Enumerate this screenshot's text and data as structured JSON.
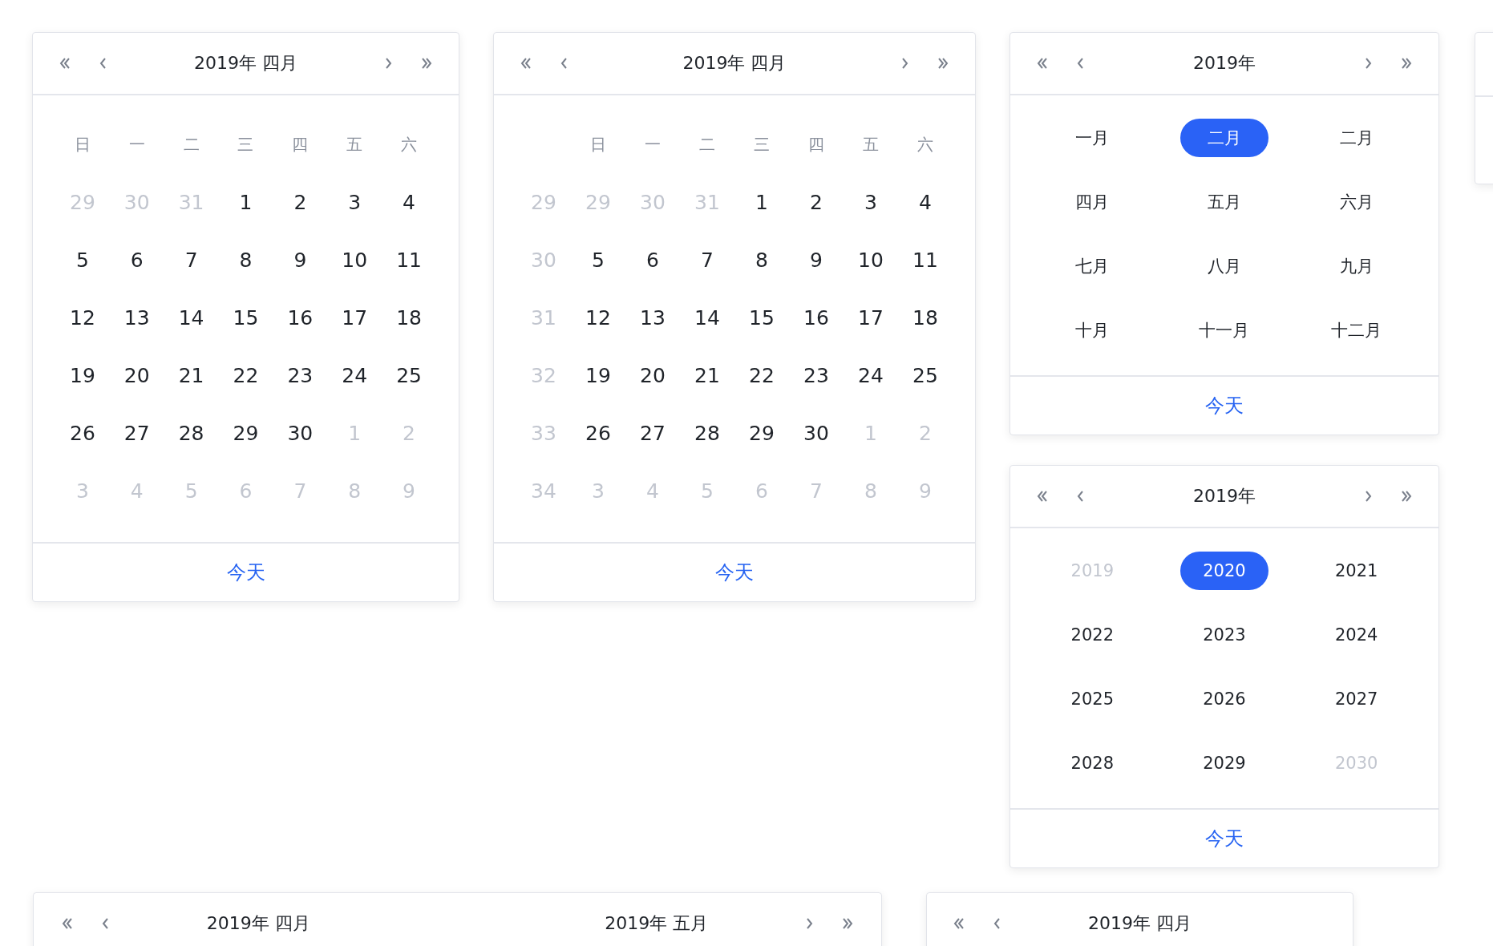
{
  "day_calendars": [
    {
      "title": "2019年 四月",
      "weekdays": [
        "日",
        "一",
        "二",
        "三",
        "四",
        "五",
        "六"
      ],
      "rows": [
        {
          "days": [
            {
              "text": "29",
              "in_month": false
            },
            {
              "text": "30",
              "in_month": false
            },
            {
              "text": "31",
              "in_month": false
            },
            {
              "text": "1",
              "in_month": true
            },
            {
              "text": "2",
              "in_month": true
            },
            {
              "text": "3",
              "in_month": true
            },
            {
              "text": "4",
              "in_month": true
            }
          ]
        },
        {
          "days": [
            {
              "text": "5",
              "in_month": true
            },
            {
              "text": "6",
              "in_month": true
            },
            {
              "text": "7",
              "in_month": true
            },
            {
              "text": "8",
              "in_month": true
            },
            {
              "text": "9",
              "in_month": true
            },
            {
              "text": "10",
              "in_month": true
            },
            {
              "text": "11",
              "in_month": true
            }
          ]
        },
        {
          "days": [
            {
              "text": "12",
              "in_month": true
            },
            {
              "text": "13",
              "in_month": true
            },
            {
              "text": "14",
              "in_month": true
            },
            {
              "text": "15",
              "in_month": true
            },
            {
              "text": "16",
              "in_month": true
            },
            {
              "text": "17",
              "in_month": true
            },
            {
              "text": "18",
              "in_month": true
            }
          ]
        },
        {
          "days": [
            {
              "text": "19",
              "in_month": true
            },
            {
              "text": "20",
              "in_month": true
            },
            {
              "text": "21",
              "in_month": true
            },
            {
              "text": "22",
              "in_month": true
            },
            {
              "text": "23",
              "in_month": true
            },
            {
              "text": "24",
              "in_month": true
            },
            {
              "text": "25",
              "in_month": true
            }
          ]
        },
        {
          "days": [
            {
              "text": "26",
              "in_month": true
            },
            {
              "text": "27",
              "in_month": true
            },
            {
              "text": "28",
              "in_month": true
            },
            {
              "text": "29",
              "in_month": true
            },
            {
              "text": "30",
              "in_month": true
            },
            {
              "text": "1",
              "in_month": false
            },
            {
              "text": "2",
              "in_month": false
            }
          ]
        },
        {
          "days": [
            {
              "text": "3",
              "in_month": false
            },
            {
              "text": "4",
              "in_month": false
            },
            {
              "text": "5",
              "in_month": false
            },
            {
              "text": "6",
              "in_month": false
            },
            {
              "text": "7",
              "in_month": false
            },
            {
              "text": "8",
              "in_month": false
            },
            {
              "text": "9",
              "in_month": false
            }
          ]
        }
      ],
      "today_link": "今天"
    },
    {
      "title": "2019年 四月",
      "weekdays": [
        "日",
        "一",
        "二",
        "三",
        "四",
        "五",
        "六"
      ],
      "rows": [
        {
          "week": "29",
          "days": [
            {
              "text": "29",
              "in_month": false
            },
            {
              "text": "30",
              "in_month": false
            },
            {
              "text": "31",
              "in_month": false
            },
            {
              "text": "1",
              "in_month": true
            },
            {
              "text": "2",
              "in_month": true
            },
            {
              "text": "3",
              "in_month": true
            },
            {
              "text": "4",
              "in_month": true
            }
          ]
        },
        {
          "week": "30",
          "days": [
            {
              "text": "5",
              "in_month": true
            },
            {
              "text": "6",
              "in_month": true
            },
            {
              "text": "7",
              "in_month": true
            },
            {
              "text": "8",
              "in_month": true
            },
            {
              "text": "9",
              "in_month": true
            },
            {
              "text": "10",
              "in_month": true
            },
            {
              "text": "11",
              "in_month": true
            }
          ]
        },
        {
          "week": "31",
          "days": [
            {
              "text": "12",
              "in_month": true
            },
            {
              "text": "13",
              "in_month": true
            },
            {
              "text": "14",
              "in_month": true
            },
            {
              "text": "15",
              "in_month": true
            },
            {
              "text": "16",
              "in_month": true
            },
            {
              "text": "17",
              "in_month": true
            },
            {
              "text": "18",
              "in_month": true
            }
          ]
        },
        {
          "week": "32",
          "days": [
            {
              "text": "19",
              "in_month": true
            },
            {
              "text": "20",
              "in_month": true
            },
            {
              "text": "21",
              "in_month": true
            },
            {
              "text": "22",
              "in_month": true
            },
            {
              "text": "23",
              "in_month": true
            },
            {
              "text": "24",
              "in_month": true
            },
            {
              "text": "25",
              "in_month": true
            }
          ]
        },
        {
          "week": "33",
          "days": [
            {
              "text": "26",
              "in_month": true
            },
            {
              "text": "27",
              "in_month": true
            },
            {
              "text": "28",
              "in_month": true
            },
            {
              "text": "29",
              "in_month": true
            },
            {
              "text": "30",
              "in_month": true
            },
            {
              "text": "1",
              "in_month": false
            },
            {
              "text": "2",
              "in_month": false
            }
          ]
        },
        {
          "week": "34",
          "days": [
            {
              "text": "3",
              "in_month": false
            },
            {
              "text": "4",
              "in_month": false
            },
            {
              "text": "5",
              "in_month": false
            },
            {
              "text": "6",
              "in_month": false
            },
            {
              "text": "7",
              "in_month": false
            },
            {
              "text": "8",
              "in_month": false
            },
            {
              "text": "9",
              "in_month": false
            }
          ]
        }
      ],
      "today_link": "今天"
    }
  ],
  "month_panel": {
    "title": "2019年",
    "months": [
      {
        "text": "一月",
        "selected": false
      },
      {
        "text": "二月",
        "selected": true
      },
      {
        "text": "二月",
        "selected": false
      },
      {
        "text": "四月",
        "selected": false
      },
      {
        "text": "五月",
        "selected": false
      },
      {
        "text": "六月",
        "selected": false
      },
      {
        "text": "七月",
        "selected": false
      },
      {
        "text": "八月",
        "selected": false
      },
      {
        "text": "九月",
        "selected": false
      },
      {
        "text": "十月",
        "selected": false
      },
      {
        "text": "十一月",
        "selected": false
      },
      {
        "text": "十二月",
        "selected": false
      }
    ],
    "today_link": "今天"
  },
  "year_panel": {
    "title": "2019年",
    "years": [
      {
        "text": "2019",
        "selected": false,
        "in_decade": false
      },
      {
        "text": "2020",
        "selected": true,
        "in_decade": true
      },
      {
        "text": "2021",
        "selected": false,
        "in_decade": true
      },
      {
        "text": "2022",
        "selected": false,
        "in_decade": true
      },
      {
        "text": "2023",
        "selected": false,
        "in_decade": true
      },
      {
        "text": "2024",
        "selected": false,
        "in_decade": true
      },
      {
        "text": "2025",
        "selected": false,
        "in_decade": true
      },
      {
        "text": "2026",
        "selected": false,
        "in_decade": true
      },
      {
        "text": "2027",
        "selected": false,
        "in_decade": true
      },
      {
        "text": "2028",
        "selected": false,
        "in_decade": true
      },
      {
        "text": "2029",
        "selected": false,
        "in_decade": true
      },
      {
        "text": "2030",
        "selected": false,
        "in_decade": false
      }
    ],
    "today_link": "今天"
  },
  "range_calendar": {
    "left_title": "2019年 四月",
    "right_title": "2019年 五月"
  },
  "partial_calendar": {
    "title": "2019年 四月"
  }
}
